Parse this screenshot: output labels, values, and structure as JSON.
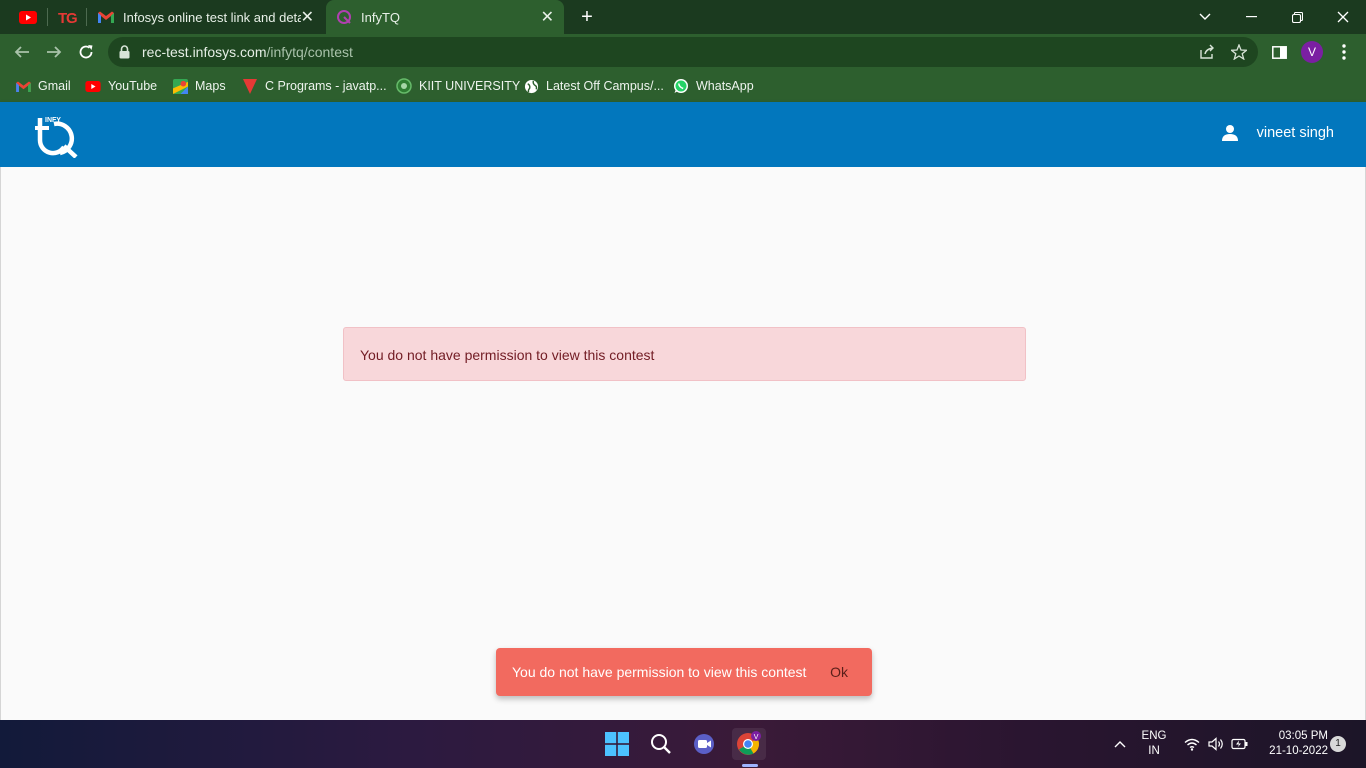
{
  "browser": {
    "tabs": [
      {
        "title": "Infosys online test link and detail",
        "active": false,
        "icon": "gmail-icon"
      },
      {
        "title": "InfyTQ",
        "active": true,
        "icon": "infytq-icon"
      }
    ],
    "url_host": "rec-test.infosys.com",
    "url_path": "/infytq/contest",
    "profile_initial": "V"
  },
  "bookmarks": [
    {
      "label": "Gmail",
      "icon": "gmail-icon"
    },
    {
      "label": "YouTube",
      "icon": "youtube-icon"
    },
    {
      "label": "Maps",
      "icon": "maps-icon"
    },
    {
      "label": "C Programs - javatp...",
      "icon": "javatpoint-icon"
    },
    {
      "label": "KIIT UNIVERSITY",
      "icon": "kiit-icon"
    },
    {
      "label": "Latest Off Campus/...",
      "icon": "globe-icon"
    },
    {
      "label": "WhatsApp",
      "icon": "whatsapp-icon"
    }
  ],
  "app": {
    "logo_text": "INFY",
    "user_name": "vineet singh",
    "alert_message": "You do not have permission to view this contest",
    "snackbar": {
      "message": "You do not have permission to view this contest",
      "action": "Ok"
    }
  },
  "taskbar": {
    "lang_line1": "ENG",
    "lang_line2": "IN",
    "time": "03:05 PM",
    "date": "21-10-2022",
    "notifications": "1",
    "chrome_badge": "V"
  },
  "colors": {
    "header": "#0277bd",
    "alert_bg": "#f8d7da",
    "alert_text": "#721c24",
    "snackbar_bg": "#f26a5f",
    "browser_frame": "#2d5f2e"
  }
}
